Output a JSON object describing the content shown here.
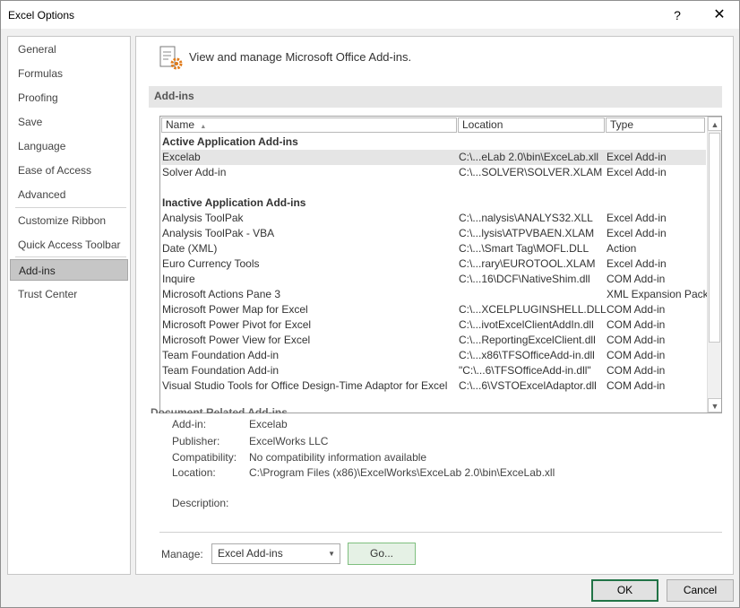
{
  "window": {
    "title": "Excel Options",
    "help_glyph": "?",
    "close_glyph": "✕"
  },
  "sidebar": {
    "items": [
      {
        "label": "General"
      },
      {
        "label": "Formulas"
      },
      {
        "label": "Proofing"
      },
      {
        "label": "Save"
      },
      {
        "label": "Language"
      },
      {
        "label": "Ease of Access"
      },
      {
        "label": "Advanced"
      },
      {
        "label": "Customize Ribbon"
      },
      {
        "label": "Quick Access Toolbar"
      },
      {
        "label": "Add-ins"
      },
      {
        "label": "Trust Center"
      }
    ],
    "selected": "Add-ins"
  },
  "main": {
    "header": "View and manage Microsoft Office Add-ins.",
    "section_title": "Add-ins"
  },
  "table": {
    "columns": [
      "Name",
      "Location",
      "Type"
    ],
    "sort_glyph": "▲",
    "groups": {
      "active": "Active Application Add-ins",
      "inactive": "Inactive Application Add-ins",
      "document_partial": "Document Related Add-ins"
    },
    "active_rows": [
      {
        "name": "Excelab",
        "location": "C:\\...eLab 2.0\\bin\\ExceLab.xll",
        "type": "Excel Add-in"
      },
      {
        "name": "Solver Add-in",
        "location": "C:\\...SOLVER\\SOLVER.XLAM",
        "type": "Excel Add-in"
      }
    ],
    "inactive_rows": [
      {
        "name": "Analysis ToolPak",
        "location": "C:\\...nalysis\\ANALYS32.XLL",
        "type": "Excel Add-in"
      },
      {
        "name": "Analysis ToolPak - VBA",
        "location": "C:\\...lysis\\ATPVBAEN.XLAM",
        "type": "Excel Add-in"
      },
      {
        "name": "Date (XML)",
        "location": "C:\\...\\Smart Tag\\MOFL.DLL",
        "type": "Action"
      },
      {
        "name": "Euro Currency Tools",
        "location": "C:\\...rary\\EUROTOOL.XLAM",
        "type": "Excel Add-in"
      },
      {
        "name": "Inquire",
        "location": "C:\\...16\\DCF\\NativeShim.dll",
        "type": "COM Add-in"
      },
      {
        "name": "Microsoft Actions Pane 3",
        "location": "",
        "type": "XML Expansion Pack"
      },
      {
        "name": "Microsoft Power Map for Excel",
        "location": "C:\\...XCELPLUGINSHELL.DLL",
        "type": "COM Add-in"
      },
      {
        "name": "Microsoft Power Pivot for Excel",
        "location": "C:\\...ivotExcelClientAddIn.dll",
        "type": "COM Add-in"
      },
      {
        "name": "Microsoft Power View for Excel",
        "location": "C:\\...ReportingExcelClient.dll",
        "type": "COM Add-in"
      },
      {
        "name": "Team Foundation Add-in",
        "location": "C:\\...x86\\TFSOfficeAdd-in.dll",
        "type": "COM Add-in"
      },
      {
        "name": "Team Foundation Add-in",
        "location": "\"C:\\...6\\TFSOfficeAdd-in.dll\"",
        "type": "COM Add-in"
      },
      {
        "name": "Visual Studio Tools for Office Design-Time Adaptor for Excel",
        "location": "C:\\...6\\VSTOExcelAdaptor.dll",
        "type": "COM Add-in"
      }
    ]
  },
  "details": {
    "addin_label": "Add-in:",
    "addin_value": "Excelab",
    "publisher_label": "Publisher:",
    "publisher_value": "ExcelWorks LLC",
    "compat_label": "Compatibility:",
    "compat_value": "No compatibility information available",
    "location_label": "Location:",
    "location_value": "C:\\Program Files (x86)\\ExcelWorks\\ExceLab 2.0\\bin\\ExceLab.xll",
    "description_label": "Description:"
  },
  "manage": {
    "label": "Manage:",
    "selected": "Excel Add-ins",
    "go_label": "Go..."
  },
  "footer": {
    "ok_label": "OK",
    "cancel_label": "Cancel"
  },
  "colors": {
    "accent": "#217346",
    "selection": "#c6c6c6",
    "go_button": "#e5f1e5"
  }
}
